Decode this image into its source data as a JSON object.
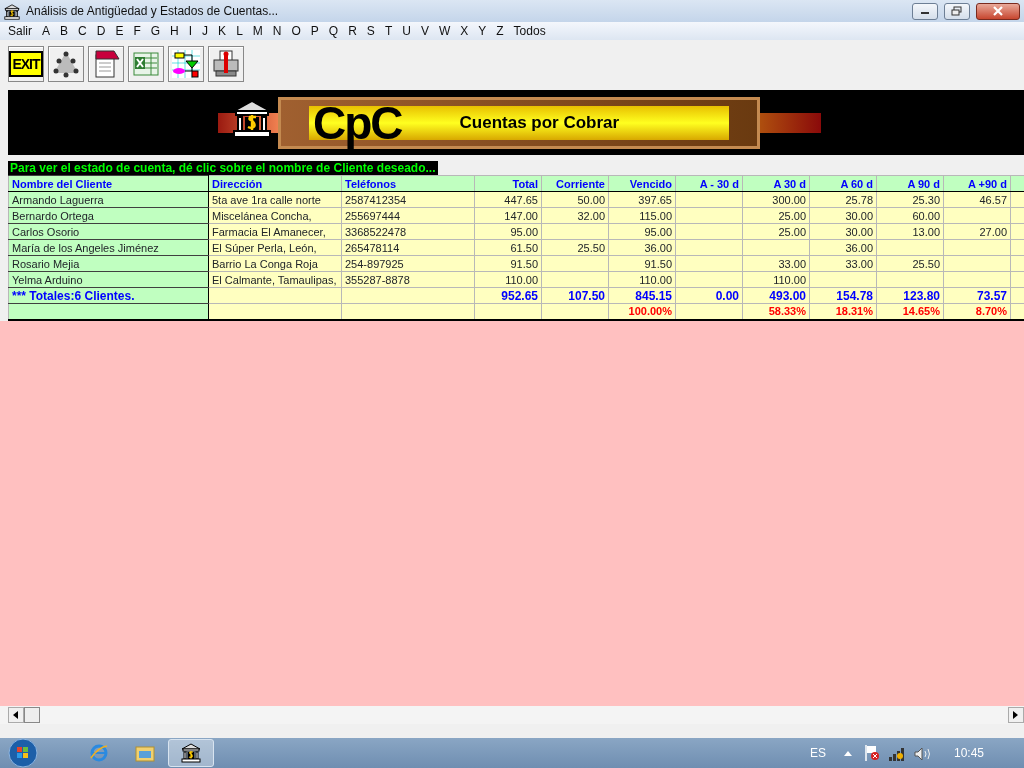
{
  "window": {
    "title": "Análisis de Antigüedad y Estados de Cuentas..."
  },
  "menu": [
    "Salir",
    "A",
    "B",
    "C",
    "D",
    "E",
    "F",
    "G",
    "H",
    "I",
    "J",
    "K",
    "L",
    "M",
    "N",
    "O",
    "P",
    "Q",
    "R",
    "S",
    "T",
    "U",
    "V",
    "W",
    "X",
    "Y",
    "Z",
    "Todos"
  ],
  "toolbar": [
    {
      "kind": "exit",
      "label": "EXIT"
    },
    {
      "kind": "group"
    },
    {
      "kind": "notepad"
    },
    {
      "kind": "excel"
    },
    {
      "kind": "flowchart"
    },
    {
      "kind": "printer"
    }
  ],
  "banner": {
    "logo": "CpC",
    "title": "Cuentas por Cobrar"
  },
  "instruction": "Para ver el estado de cuenta, dé clic sobre el nombre de Cliente deseado...",
  "table": {
    "columns": [
      "Nombre del Cliente",
      "Dirección",
      "Teléfonos",
      "Total",
      "Corriente",
      "Vencido",
      "A - 30 d",
      "A 30 d",
      "A 60 d",
      "A 90 d",
      "A +90 d"
    ],
    "rows": [
      {
        "name": "Armando Laguerra",
        "address": "5ta ave 1ra calle norte",
        "phone": "2587412354",
        "total": "447.65",
        "current": "50.00",
        "overdue": "397.65",
        "d30": "300.00",
        "d60": "25.78",
        "d90": "25.30",
        "over90": "46.57"
      },
      {
        "name": "Bernardo Ortega",
        "address": "Miscelánea Concha,",
        "phone": "255697444",
        "total": "147.00",
        "current": "32.00",
        "overdue": "115.00",
        "d30": "25.00",
        "d60": "30.00",
        "d90": "60.00"
      },
      {
        "name": "Carlos Osorio",
        "address": "Farmacia El Amanecer,",
        "phone": "3368522478",
        "total": "95.00",
        "overdue": "95.00",
        "d30": "25.00",
        "d60": "30.00",
        "d90": "13.00",
        "over90": "27.00"
      },
      {
        "name": "María de los Angeles Jiménez",
        "address": "El Súper Perla, León,",
        "phone": "265478114",
        "total": "61.50",
        "current": "25.50",
        "overdue": "36.00",
        "d60": "36.00"
      },
      {
        "name": "Rosario Mejia",
        "address": "Barrio La Conga Roja",
        "phone": "254-897925",
        "total": "91.50",
        "overdue": "91.50",
        "d30": "33.00",
        "d60": "33.00",
        "d90": "25.50"
      },
      {
        "name": "Yelma Arduino",
        "address": "El Calmante, Tamaulipas,",
        "phone": "355287-8878",
        "total": "110.00",
        "overdue": "110.00",
        "d30": "110.00"
      }
    ],
    "totals": {
      "name": "*** Totales:6 Clientes.",
      "total": "952.65",
      "current": "107.50",
      "overdue": "845.15",
      "under30": "0.00",
      "d30": "493.00",
      "d60": "154.78",
      "d90": "123.80",
      "over90": "73.57"
    },
    "percents": {
      "overdue": "100.00%",
      "d30": "58.33%",
      "d60": "18.31%",
      "d90": "14.65%",
      "over90": "8.70%"
    }
  },
  "taskbar": {
    "language": "ES",
    "clock": "10:45"
  }
}
